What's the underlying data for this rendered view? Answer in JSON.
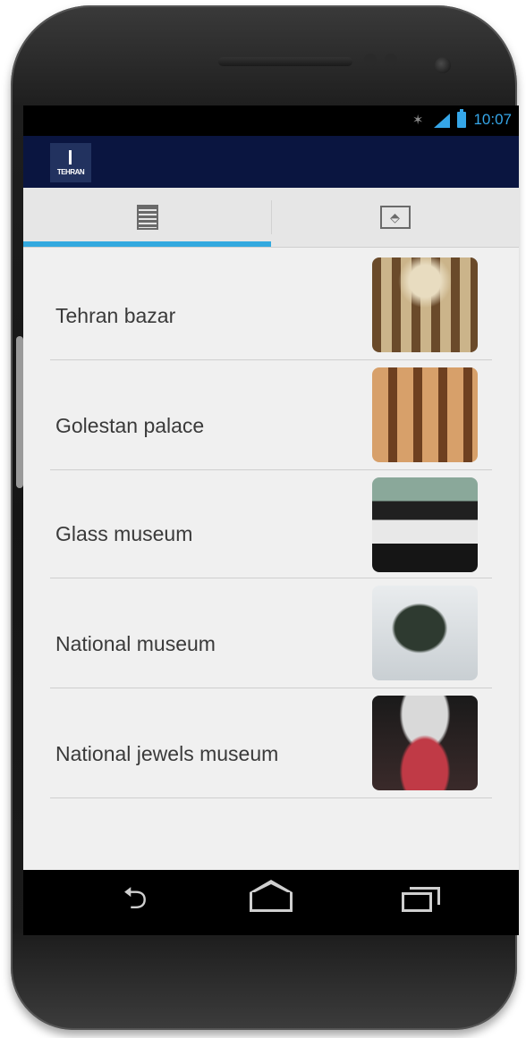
{
  "status_bar": {
    "time": "10:07",
    "icons": [
      "activity-icon",
      "signal-icon",
      "battery-icon"
    ],
    "accent_color": "#35a6e8"
  },
  "action_bar": {
    "logo_text": "TEHRAN",
    "background_color": "#0a1540"
  },
  "tabs": [
    {
      "icon": "list-icon",
      "selected": true
    },
    {
      "icon": "map-icon",
      "selected": false
    }
  ],
  "tab_indicator_color": "#33a9df",
  "places": [
    {
      "name": "Tehran bazar",
      "thumbnail": "bazaar-photo"
    },
    {
      "name": "Golestan palace",
      "thumbnail": "palace-photo"
    },
    {
      "name": "Glass museum",
      "thumbnail": "glass-museum-photo"
    },
    {
      "name": "National museum",
      "thumbnail": "national-museum-photo"
    },
    {
      "name": "National jewels museum",
      "thumbnail": "jewels-museum-photo"
    }
  ],
  "nav_bar": {
    "buttons": [
      "back-icon",
      "home-icon",
      "recent-apps-icon"
    ]
  }
}
